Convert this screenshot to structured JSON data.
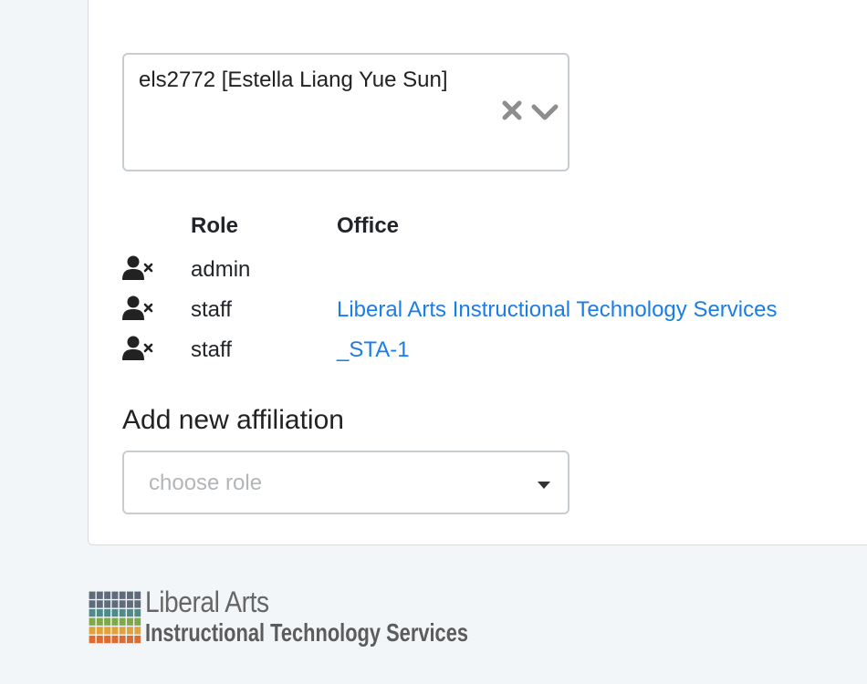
{
  "user_select": {
    "value": "els2772 [Estella Liang Yue Sun]",
    "clear_icon": "close-icon",
    "dropdown_icon": "chevron-down-icon"
  },
  "affiliations": {
    "headers": {
      "role": "Role",
      "office": "Office"
    },
    "rows": [
      {
        "role": "admin",
        "office": "",
        "icon": "user-remove-icon"
      },
      {
        "role": "staff",
        "office": "Liberal Arts Instructional Technology Services",
        "icon": "user-remove-icon"
      },
      {
        "role": "staff",
        "office": "_STA-1",
        "icon": "user-remove-icon"
      }
    ]
  },
  "add_affiliation": {
    "title": "Add new affiliation",
    "role_placeholder": "choose role"
  },
  "footer": {
    "logo_line1": "Liberal Arts",
    "logo_line2": "Instructional Technology Services"
  },
  "colors": {
    "link": "#1a7ee6",
    "background": "#f3f6f9",
    "border": "#c8cdd2"
  }
}
